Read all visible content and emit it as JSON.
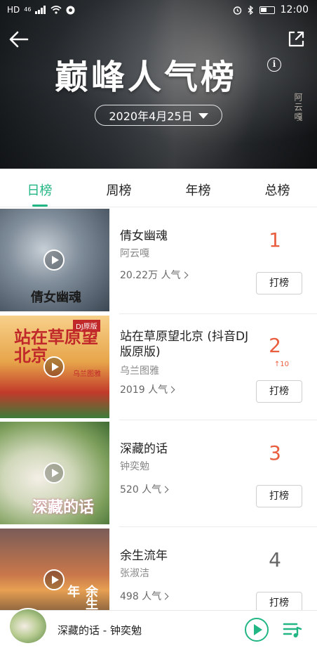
{
  "status_bar": {
    "left_indicators": [
      "HD",
      "46",
      "signal-icon",
      "wifi-icon",
      "vpn-icon"
    ],
    "time": "12:00"
  },
  "header": {
    "title": "巅峰人气榜",
    "date": "2020年4月25日",
    "credit": "阿云嘎",
    "accent_color": "#22b684"
  },
  "tabs": [
    {
      "label": "日榜",
      "active": true
    },
    {
      "label": "周榜",
      "active": false
    },
    {
      "label": "年榜",
      "active": false
    },
    {
      "label": "总榜",
      "active": false
    }
  ],
  "songs": [
    {
      "rank": "1",
      "title": "倩女幽魂",
      "artist": "阿云嘎",
      "popularity": "20.22万 人气",
      "change": "",
      "button": "打榜",
      "cover_text": "倩女幽魂"
    },
    {
      "rank": "2",
      "title": "站在草原望北京 (抖音DJ版原版)",
      "artist": "乌兰图雅",
      "popularity": "2019 人气",
      "change": "↑10",
      "button": "打榜",
      "cover_text": "站在草原望北京",
      "cover_badge": "DJ原版",
      "cover_sub": "乌兰图雅"
    },
    {
      "rank": "3",
      "title": "深藏的话",
      "artist": "钟奕勉",
      "popularity": "520 人气",
      "change": "",
      "button": "打榜",
      "cover_text": "深藏的话"
    },
    {
      "rank": "4",
      "title": "余生流年",
      "artist": "张淑洁",
      "popularity": "498 人气",
      "change": "",
      "button": "打榜",
      "cover_text": "余生流年"
    }
  ],
  "player": {
    "now_playing": "深藏的话 - 钟奕勉"
  }
}
